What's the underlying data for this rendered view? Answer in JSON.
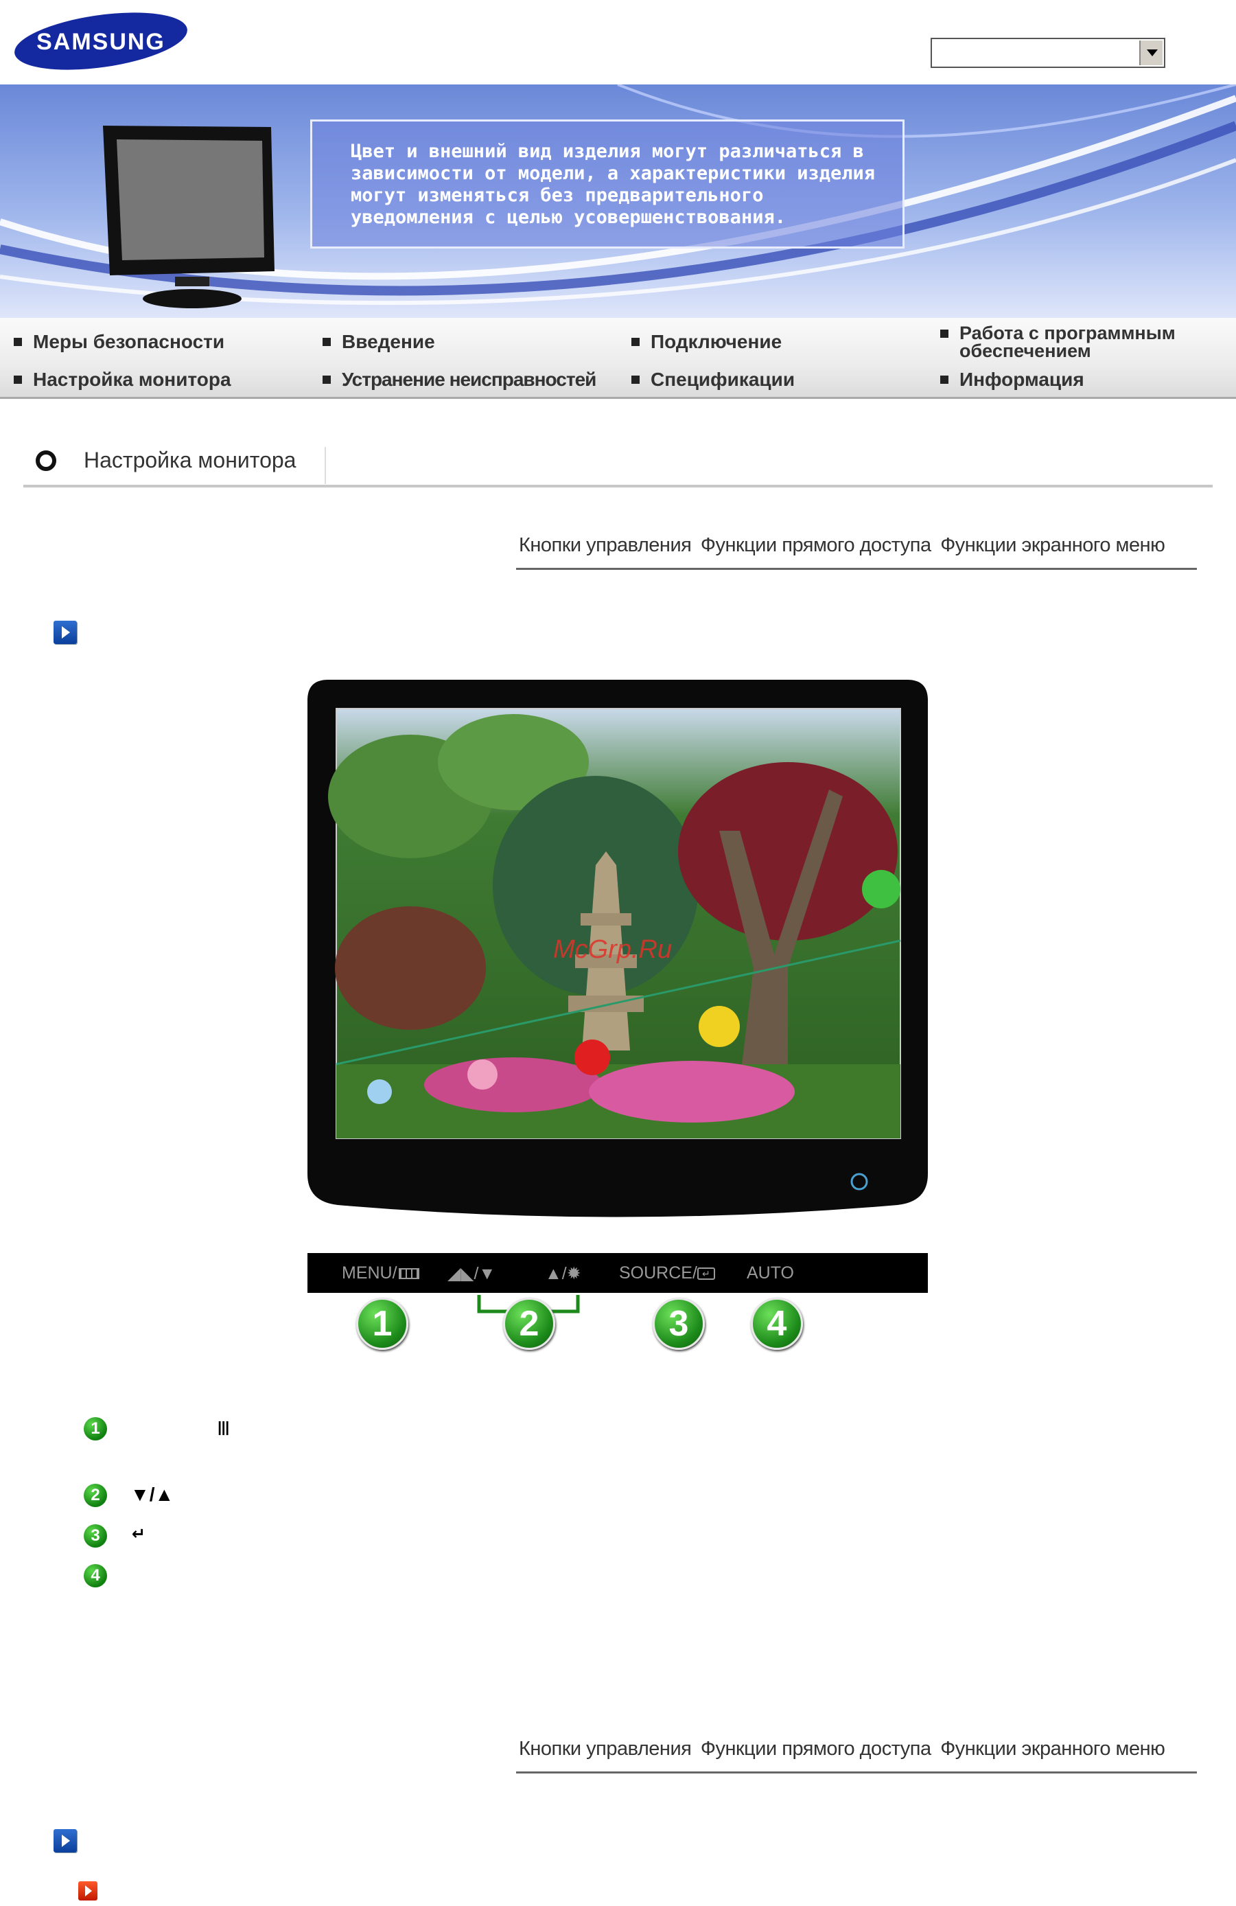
{
  "header": {
    "brand": "SAMSUNG",
    "model_select_value": ""
  },
  "banner": {
    "message": "Цвет и внешний вид изделия могут различаться в\nзависимости от модели, а характеристики изделия\nмогут изменяться без предварительного\nуведомления с целью усовершенствования."
  },
  "nav": {
    "items": [
      {
        "label": "Меры безопасности"
      },
      {
        "label": "Введение"
      },
      {
        "label": "Подключение"
      },
      {
        "label": "Работа с программным обеспечением"
      },
      {
        "label": "Настройка монитора"
      },
      {
        "label": "Устранение неисправностей"
      },
      {
        "label": "Спецификации"
      },
      {
        "label": "Информация"
      }
    ]
  },
  "section": {
    "title": "Настройка монитора"
  },
  "tabs": {
    "items": [
      {
        "label": "Кнопки управления"
      },
      {
        "label": "Функции прямого доступа"
      },
      {
        "label": "Функции экранного меню"
      }
    ]
  },
  "watermark": "McGrp.Ru",
  "button_bar": {
    "menu": "MENU/",
    "source": "SOURCE/",
    "auto": "AUTO"
  },
  "callouts": [
    "1",
    "2",
    "3",
    "4"
  ],
  "list": [
    {
      "num": "1",
      "symbol": "Ⅲ"
    },
    {
      "num": "2",
      "symbol": "▼/▲"
    },
    {
      "num": "3",
      "symbol": "↵"
    },
    {
      "num": "4",
      "symbol": ""
    }
  ],
  "colors": {
    "accent_blue": "#0b3f9c",
    "badge_green": "#1c8a1a",
    "banner_blue": "#5a6fd0"
  }
}
